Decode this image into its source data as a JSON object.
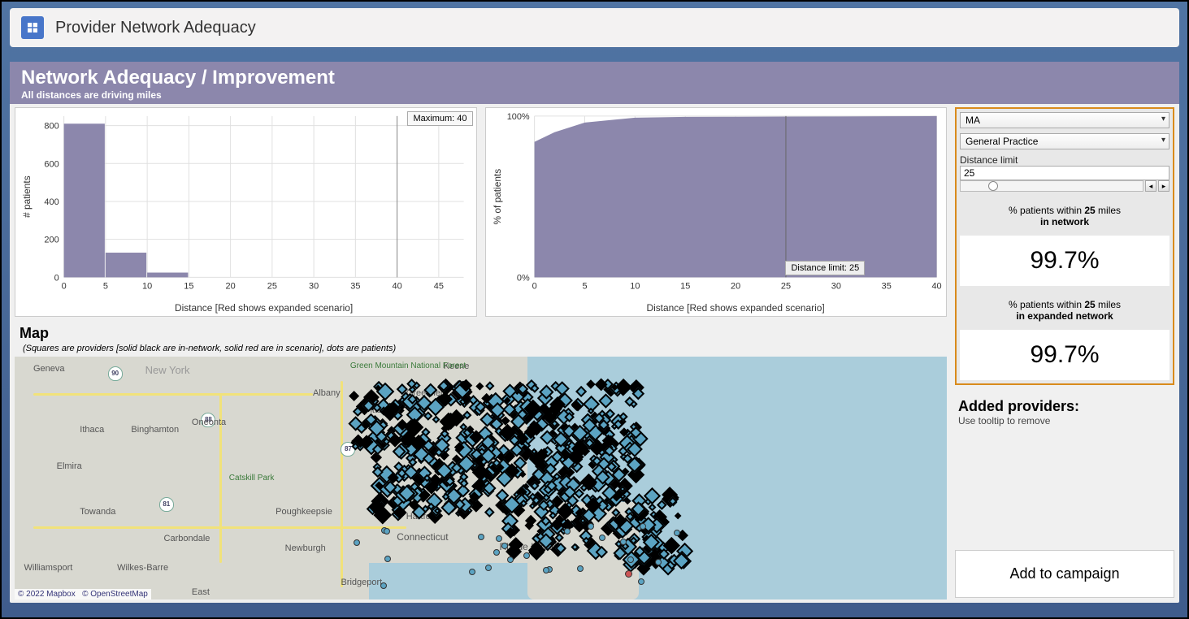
{
  "app": {
    "title": "Provider Network Adequacy"
  },
  "banner": {
    "title": "Network Adequacy / Improvement",
    "subtitle": "All distances are driving miles"
  },
  "chart_data": [
    {
      "type": "bar",
      "name": "histogram",
      "title": "",
      "xlabel": "Distance [Red shows expanded scenario]",
      "ylabel": "# patients",
      "x_ticks": [
        0,
        5,
        10,
        15,
        20,
        25,
        30,
        35,
        40,
        45
      ],
      "y_ticks": [
        0,
        200,
        400,
        600,
        800
      ],
      "xlim": [
        0,
        48
      ],
      "ylim": [
        0,
        850
      ],
      "annotations": {
        "max_label": "Maximum: 40"
      },
      "bars": [
        {
          "x0": 0,
          "x1": 5,
          "value": 810
        },
        {
          "x0": 5,
          "x1": 10,
          "value": 130
        },
        {
          "x0": 10,
          "x1": 15,
          "value": 25
        }
      ]
    },
    {
      "type": "area",
      "name": "cumulative",
      "title": "",
      "xlabel": "Distance [Red shows expanded scenario]",
      "ylabel": "% of patients",
      "x_ticks": [
        0,
        5,
        10,
        15,
        20,
        25,
        30,
        35,
        40
      ],
      "y_tick_labels": [
        "0%",
        "100%"
      ],
      "xlim": [
        0,
        40
      ],
      "ylim": [
        0,
        100
      ],
      "annotations": {
        "limit_label": "Distance limit: 25",
        "limit_x": 25
      },
      "points": [
        {
          "x": 0,
          "y": 84
        },
        {
          "x": 2,
          "y": 90
        },
        {
          "x": 5,
          "y": 96
        },
        {
          "x": 10,
          "y": 99
        },
        {
          "x": 15,
          "y": 99.5
        },
        {
          "x": 20,
          "y": 99.6
        },
        {
          "x": 25,
          "y": 99.7
        },
        {
          "x": 30,
          "y": 99.8
        },
        {
          "x": 35,
          "y": 99.9
        },
        {
          "x": 40,
          "y": 100
        }
      ]
    }
  ],
  "filters": {
    "state": {
      "selected": "MA"
    },
    "specialty": {
      "selected": "General Practice"
    },
    "distance_limit_label": "Distance limit",
    "distance_limit_value": "25"
  },
  "stats": {
    "in_network": {
      "caption_prefix": "% patients within ",
      "caption_distance": "25",
      "caption_suffix": " miles",
      "caption_line2": "in network",
      "value": "99.7%"
    },
    "expanded": {
      "caption_prefix": "% patients within ",
      "caption_distance": "25",
      "caption_suffix": " miles",
      "caption_line2": "in expanded network",
      "value": "99.7%"
    }
  },
  "map": {
    "title": "Map",
    "subtitle": "(Squares are providers [solid black are in-network, solid red are in scenario], dots are patients)",
    "labels": [
      "Geneva",
      "Ithaca",
      "Elmira",
      "Towanda",
      "Williamsport",
      "Wilkes-Barre",
      "Binghamton",
      "Oneonta",
      "Carbondale",
      "Poughkeepsie",
      "Newburgh",
      "Bridgeport",
      "Hartford",
      "Albany",
      "Pittsfield",
      "Greenfield",
      "Keene",
      "Rhode Island",
      "Connecticut",
      "New York",
      "Green Mountain National Forest",
      "Catskill Park",
      "East"
    ],
    "attrib_mapbox": "© 2022 Mapbox",
    "attrib_osm": "© OpenStreetMap"
  },
  "added_providers": {
    "title": "Added providers:",
    "hint": "Use tooltip to remove"
  },
  "buttons": {
    "add_to_campaign": "Add to campaign"
  }
}
